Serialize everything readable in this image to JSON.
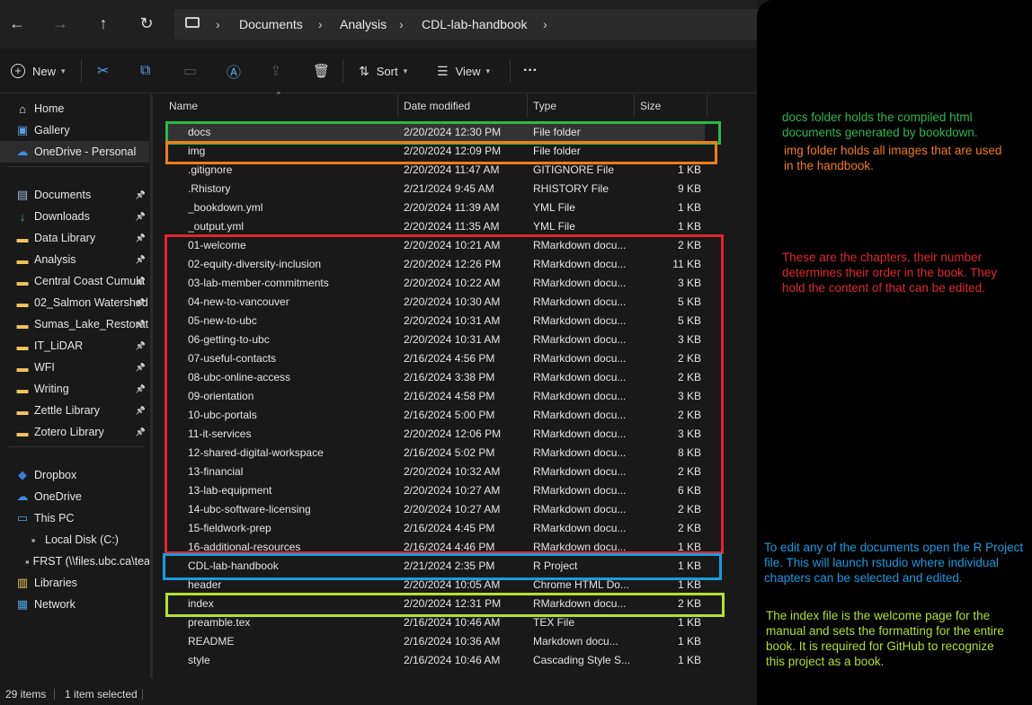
{
  "nav": {
    "back": "←",
    "forward": "→",
    "up": "↑",
    "refresh": "↻"
  },
  "breadcrumb": {
    "items": [
      "Documents",
      "Analysis",
      "CDL-lab-handbook"
    ],
    "sep": "›"
  },
  "toolbar": {
    "new_label": "New",
    "sort_label": "Sort",
    "view_label": "View",
    "more": "···"
  },
  "sidebar": {
    "items": [
      {
        "label": "Home",
        "icon": "home-icon"
      },
      {
        "label": "Gallery",
        "icon": "gallery-icon"
      },
      {
        "label": "OneDrive - Personal",
        "icon": "cloud-icon"
      },
      {
        "label": "Documents",
        "icon": "documents-icon"
      },
      {
        "label": "Downloads",
        "icon": "downloads-icon"
      },
      {
        "label": "Data Library",
        "icon": "folder-icon"
      },
      {
        "label": "Analysis",
        "icon": "folder-icon"
      },
      {
        "label": "Central Coast Cumula",
        "icon": "folder-icon"
      },
      {
        "label": "02_Salmon Watershed",
        "icon": "folder-icon"
      },
      {
        "label": "Sumas_Lake_Restorat",
        "icon": "folder-icon"
      },
      {
        "label": "IT_LiDAR",
        "icon": "folder-icon"
      },
      {
        "label": "WFI",
        "icon": "folder-icon"
      },
      {
        "label": "Writing",
        "icon": "folder-icon"
      },
      {
        "label": "Zettle Library",
        "icon": "folder-icon"
      },
      {
        "label": "Zotero Library",
        "icon": "folder-icon"
      },
      {
        "label": "Dropbox",
        "icon": "dropbox-icon"
      },
      {
        "label": "OneDrive",
        "icon": "cloud-icon"
      },
      {
        "label": "This PC",
        "icon": "pc-icon"
      },
      {
        "label": "Local Disk (C:)",
        "icon": "disk-icon"
      },
      {
        "label": "FRST (\\\\files.ubc.ca\\tea",
        "icon": "network-drive-icon"
      },
      {
        "label": "Libraries",
        "icon": "libraries-icon"
      },
      {
        "label": "Network",
        "icon": "network-icon"
      }
    ]
  },
  "columns": {
    "name": "Name",
    "date": "Date modified",
    "type": "Type",
    "size": "Size"
  },
  "files": [
    {
      "name": "docs",
      "date": "2/20/2024 12:30 PM",
      "type": "File folder",
      "size": "",
      "icon": "folder"
    },
    {
      "name": "img",
      "date": "2/20/2024 12:09 PM",
      "type": "File folder",
      "size": "",
      "icon": "folder"
    },
    {
      "name": ".gitignore",
      "date": "2/20/2024 11:47 AM",
      "type": "GITIGNORE File",
      "size": "1 KB",
      "icon": "doc"
    },
    {
      "name": ".Rhistory",
      "date": "2/21/2024 9:45 AM",
      "type": "RHISTORY File",
      "size": "9 KB",
      "icon": "doc"
    },
    {
      "name": "_bookdown.yml",
      "date": "2/20/2024 11:39 AM",
      "type": "YML File",
      "size": "1 KB",
      "icon": "doc"
    },
    {
      "name": "_output.yml",
      "date": "2/20/2024 11:35 AM",
      "type": "YML File",
      "size": "1 KB",
      "icon": "doc"
    },
    {
      "name": "01-welcome",
      "date": "2/20/2024 10:21 AM",
      "type": "RMarkdown docu...",
      "size": "2 KB",
      "icon": "rmd"
    },
    {
      "name": "02-equity-diversity-inclusion",
      "date": "2/20/2024 12:26 PM",
      "type": "RMarkdown docu...",
      "size": "11 KB",
      "icon": "rmd"
    },
    {
      "name": "03-lab-member-commitments",
      "date": "2/20/2024 10:22 AM",
      "type": "RMarkdown docu...",
      "size": "3 KB",
      "icon": "rmd"
    },
    {
      "name": "04-new-to-vancouver",
      "date": "2/20/2024 10:30 AM",
      "type": "RMarkdown docu...",
      "size": "5 KB",
      "icon": "rmd"
    },
    {
      "name": "05-new-to-ubc",
      "date": "2/20/2024 10:31 AM",
      "type": "RMarkdown docu...",
      "size": "5 KB",
      "icon": "rmd"
    },
    {
      "name": "06-getting-to-ubc",
      "date": "2/20/2024 10:31 AM",
      "type": "RMarkdown docu...",
      "size": "3 KB",
      "icon": "rmd"
    },
    {
      "name": "07-useful-contacts",
      "date": "2/16/2024 4:56 PM",
      "type": "RMarkdown docu...",
      "size": "2 KB",
      "icon": "rmd"
    },
    {
      "name": "08-ubc-online-access",
      "date": "2/16/2024 3:38 PM",
      "type": "RMarkdown docu...",
      "size": "2 KB",
      "icon": "rmd"
    },
    {
      "name": "09-orientation",
      "date": "2/16/2024 4:58 PM",
      "type": "RMarkdown docu...",
      "size": "3 KB",
      "icon": "rmd"
    },
    {
      "name": "10-ubc-portals",
      "date": "2/16/2024 5:00 PM",
      "type": "RMarkdown docu...",
      "size": "2 KB",
      "icon": "rmd"
    },
    {
      "name": "11-it-services",
      "date": "2/20/2024 12:06 PM",
      "type": "RMarkdown docu...",
      "size": "3 KB",
      "icon": "rmd"
    },
    {
      "name": "12-shared-digital-workspace",
      "date": "2/16/2024 5:02 PM",
      "type": "RMarkdown docu...",
      "size": "8 KB",
      "icon": "rmd"
    },
    {
      "name": "13-financial",
      "date": "2/20/2024 10:32 AM",
      "type": "RMarkdown docu...",
      "size": "2 KB",
      "icon": "rmd"
    },
    {
      "name": "13-lab-equipment",
      "date": "2/20/2024 10:27 AM",
      "type": "RMarkdown docu...",
      "size": "6 KB",
      "icon": "rmd"
    },
    {
      "name": "14-ubc-software-licensing",
      "date": "2/20/2024 10:27 AM",
      "type": "RMarkdown docu...",
      "size": "2 KB",
      "icon": "rmd"
    },
    {
      "name": "15-fieldwork-prep",
      "date": "2/16/2024 4:45 PM",
      "type": "RMarkdown docu...",
      "size": "2 KB",
      "icon": "rmd"
    },
    {
      "name": "16-additional-resources",
      "date": "2/16/2024 4:46 PM",
      "type": "RMarkdown docu...",
      "size": "1 KB",
      "icon": "rmd"
    },
    {
      "name": "CDL-lab-handbook",
      "date": "2/21/2024 2:35 PM",
      "type": "R Project",
      "size": "1 KB",
      "icon": "rproj"
    },
    {
      "name": "header",
      "date": "2/20/2024 10:05 AM",
      "type": "Chrome HTML Do...",
      "size": "1 KB",
      "icon": "chrome"
    },
    {
      "name": "index",
      "date": "2/20/2024 12:31 PM",
      "type": "RMarkdown docu...",
      "size": "2 KB",
      "icon": "rmd"
    },
    {
      "name": "preamble.tex",
      "date": "2/16/2024 10:46 AM",
      "type": "TEX File",
      "size": "1 KB",
      "icon": "doc"
    },
    {
      "name": "README",
      "date": "2/16/2024 10:36 AM",
      "type": "Markdown docu...",
      "size": "1 KB",
      "icon": "md"
    },
    {
      "name": "style",
      "date": "2/16/2024 10:46 AM",
      "type": "Cascading Style S...",
      "size": "1 KB",
      "icon": "doc"
    }
  ],
  "status": {
    "count": "29 items",
    "selected": "1 item selected"
  },
  "annotations": {
    "docs": "docs folder holds the compiled html documents generated by bookdown.",
    "img": "img folder holds all images that are used in the handbook.",
    "chapters": "These are the chapters, their number determines their order in the book. They hold the content of that can be edited.",
    "rproject": "To edit any of the documents open the R Project file. This will launch rstudio where individual chapters can be selected and edited.",
    "index": "The index file is the welcome page for the manual and sets the formatting for the entire book. It is required for GitHub to recognize this project as a book."
  },
  "colors": {
    "green": "#2db84a",
    "orange": "#f07c1a",
    "red": "#e0262c",
    "blue": "#1a9ae0",
    "lime": "#b5e02a"
  }
}
